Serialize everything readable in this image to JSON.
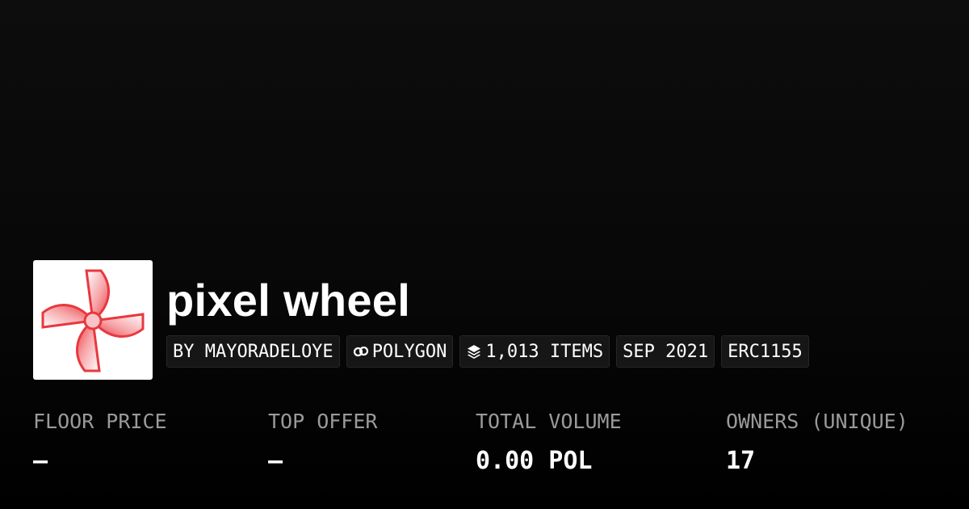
{
  "collection": {
    "name": "pixel wheel",
    "logo_icon": "pinwheel-logo",
    "logo_color": "#e8383f"
  },
  "badges": [
    {
      "label": "BY MAYORADELOYE",
      "icon": null
    },
    {
      "label": "POLYGON",
      "icon": "chain-link-icon"
    },
    {
      "label": "1,013 ITEMS",
      "icon": "layers-icon"
    },
    {
      "label": "SEP 2021",
      "icon": null
    },
    {
      "label": "ERC1155",
      "icon": null
    }
  ],
  "stats": [
    {
      "label": "FLOOR PRICE",
      "value": "–"
    },
    {
      "label": "TOP OFFER",
      "value": "–"
    },
    {
      "label": "TOTAL VOLUME",
      "value": "0.00 POL"
    },
    {
      "label": "OWNERS (UNIQUE)",
      "value": "17"
    }
  ]
}
